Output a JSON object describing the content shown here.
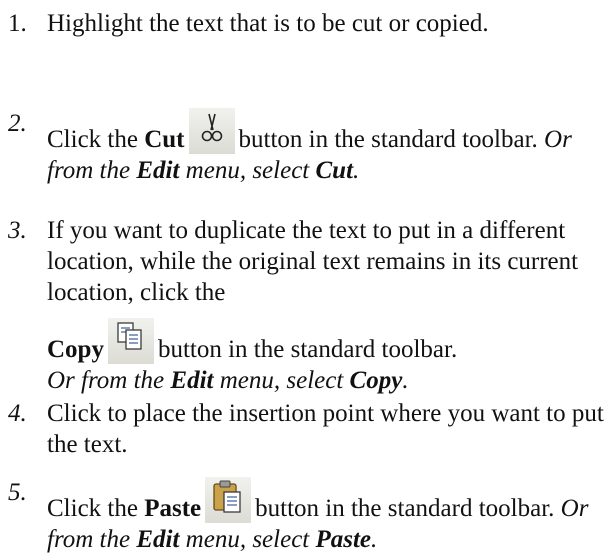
{
  "steps": [
    {
      "num": "1.",
      "text": "Highlight the text that is to be cut or copied."
    },
    {
      "num": "2.",
      "pre": "Click the",
      "button_label": "Cut",
      "post": "button in the standard toolbar.",
      "alt_pre": "Or from the",
      "alt_menu": "Edit",
      "alt_mid": "menu, select",
      "alt_cmd": "Cut",
      "alt_end": ".",
      "icon": "scissors-icon"
    },
    {
      "num": "3.",
      "text": "If you want to duplicate the text to put in a different location, while the original text remains in its current location, click the",
      "button_label": "Copy",
      "post": "button in the standard toolbar.",
      "alt_pre": "Or from the",
      "alt_menu": "Edit",
      "alt_mid": "menu, select",
      "alt_cmd": "Copy",
      "alt_end": ".",
      "icon": "copy-icon"
    },
    {
      "num": "4.",
      "text": "Click to place the insertion point where you want to put the text."
    },
    {
      "num": "5.",
      "pre": "Click the",
      "button_label": "Paste",
      "post": "button in the standard toolbar.",
      "alt_pre": "Or from the",
      "alt_menu": "Edit",
      "alt_mid": "menu, select",
      "alt_cmd": "Paste",
      "alt_end": ".",
      "icon": "clipboard-paste-icon"
    }
  ]
}
